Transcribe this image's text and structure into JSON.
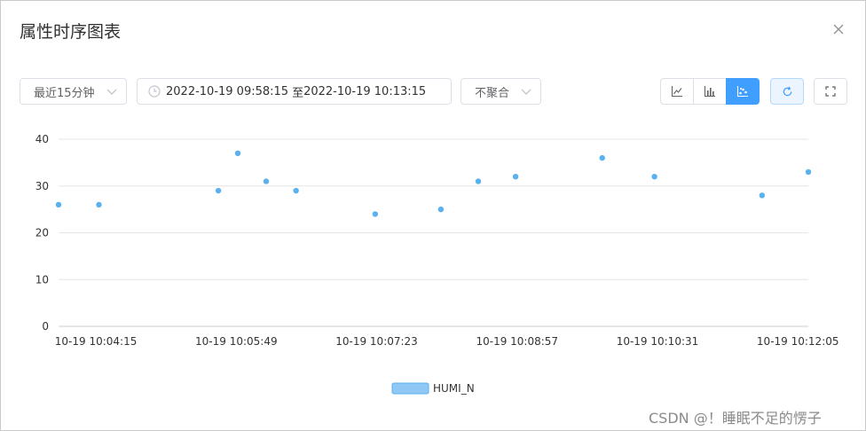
{
  "dialog": {
    "title": "属性时序图表",
    "close_icon": "close-icon"
  },
  "toolbar": {
    "time_range": "最近15分钟",
    "date_start": "2022-10-19 09:58:15",
    "date_sep": "至",
    "date_end": "2022-10-19 10:13:15",
    "aggregation": "不聚合",
    "chart_type_buttons": [
      {
        "icon": "line-chart-icon",
        "active": false
      },
      {
        "icon": "bar-chart-icon",
        "active": false
      },
      {
        "icon": "scatter-chart-icon",
        "active": true
      }
    ],
    "refresh_icon": "refresh-icon",
    "fullscreen_icon": "fullscreen-icon",
    "accent_color": "#409eff"
  },
  "chart_data": {
    "type": "scatter",
    "series": [
      {
        "name": "HUMI_N",
        "color": "#5ab1ef",
        "points": [
          {
            "x": "10:03:50",
            "y": 26
          },
          {
            "x": "10:04:17",
            "y": 26
          },
          {
            "x": "10:05:37",
            "y": 29
          },
          {
            "x": "10:05:50",
            "y": 37
          },
          {
            "x": "10:06:09",
            "y": 31
          },
          {
            "x": "10:06:29",
            "y": 29
          },
          {
            "x": "10:07:22",
            "y": 24
          },
          {
            "x": "10:08:06",
            "y": 25
          },
          {
            "x": "10:08:31",
            "y": 31
          },
          {
            "x": "10:08:56",
            "y": 32
          },
          {
            "x": "10:09:54",
            "y": 36
          },
          {
            "x": "10:10:29",
            "y": 32
          },
          {
            "x": "10:11:41",
            "y": 28
          },
          {
            "x": "10:12:12",
            "y": 33
          }
        ]
      }
    ],
    "x_ticks": [
      "10-19 10:04:15",
      "10-19 10:05:49",
      "10-19 10:07:23",
      "10-19 10:08:57",
      "10-19 10:10:31",
      "10-19 10:12:05"
    ],
    "x_ticks_time": [
      "10:04:15",
      "10:05:49",
      "10:07:23",
      "10:08:57",
      "10:10:31",
      "10:12:05"
    ],
    "y_ticks": [
      "40",
      "30",
      "20",
      "10",
      "0"
    ],
    "ylim": [
      0,
      40
    ],
    "grid": true,
    "legend_placement": "bottom-center"
  },
  "watermark": "CSDN @！睡眠不足的愣子"
}
